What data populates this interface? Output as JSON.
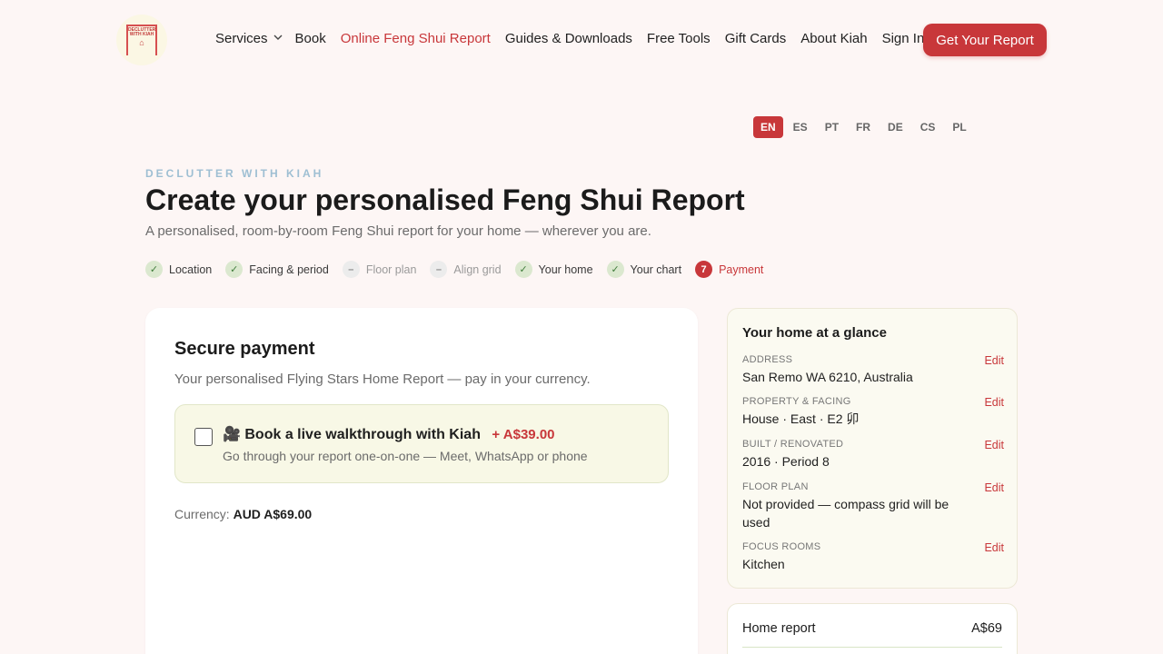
{
  "brand": {
    "logo_text": "DECLUTTER WITH KIAH"
  },
  "nav": {
    "items": [
      {
        "label": "Services",
        "has_dropdown": true
      },
      {
        "label": "Book"
      },
      {
        "label": "Online Feng Shui Report",
        "active": true
      },
      {
        "label": "Guides & Downloads"
      },
      {
        "label": "Free Tools"
      },
      {
        "label": "Gift Cards"
      },
      {
        "label": "About Kiah"
      },
      {
        "label": "Sign In"
      }
    ],
    "cta_label": "Get Your Report"
  },
  "languages": {
    "items": [
      "EN",
      "ES",
      "PT",
      "FR",
      "DE",
      "CS",
      "PL"
    ],
    "selected": "EN"
  },
  "header": {
    "eyebrow": "DECLUTTER WITH KIAH",
    "title": "Create your personalised Feng Shui Report",
    "subtitle": "A personalised, room-by-room Feng Shui report for your home — wherever you are."
  },
  "steps": [
    {
      "label": "Location",
      "state": "done",
      "mark": "✓"
    },
    {
      "label": "Facing & period",
      "state": "done",
      "mark": "✓"
    },
    {
      "label": "Floor plan",
      "state": "skipped",
      "mark": "–"
    },
    {
      "label": "Align grid",
      "state": "skipped",
      "mark": "–"
    },
    {
      "label": "Your home",
      "state": "done",
      "mark": "✓"
    },
    {
      "label": "Your chart",
      "state": "done",
      "mark": "✓"
    },
    {
      "label": "Payment",
      "state": "current",
      "mark": "7"
    }
  ],
  "payment": {
    "title": "Secure payment",
    "description": "Your personalised Flying Stars Home Report — pay in your currency.",
    "addon": {
      "icon": "video-camera-icon",
      "emoji": "🎥",
      "title": "Book a live walkthrough with Kiah",
      "price": "+ A$39.00",
      "description": "Go through your report one-on-one — Meet, WhatsApp or phone",
      "checked": false
    },
    "currency_label": "Currency:",
    "currency_value": "AUD A$69.00"
  },
  "glance": {
    "title": "Your home at a glance",
    "edit_label": "Edit",
    "rows": [
      {
        "label": "ADDRESS",
        "value": "San Remo WA 6210, Australia"
      },
      {
        "label": "PROPERTY & FACING",
        "value": "House · East · E2 卯"
      },
      {
        "label": "BUILT / RENOVATED",
        "value": "2016 · Period 8"
      },
      {
        "label": "FLOOR PLAN",
        "value": "Not provided — compass grid will be used"
      },
      {
        "label": "FOCUS ROOMS",
        "value": "Kitchen"
      }
    ]
  },
  "summary": {
    "label": "Home report",
    "price": "A$69"
  },
  "colors": {
    "accent": "#c8373a",
    "page_bg": "#fdf6f5",
    "done_green": "#dbe8cf",
    "eyebrow": "#9ebfd3"
  }
}
